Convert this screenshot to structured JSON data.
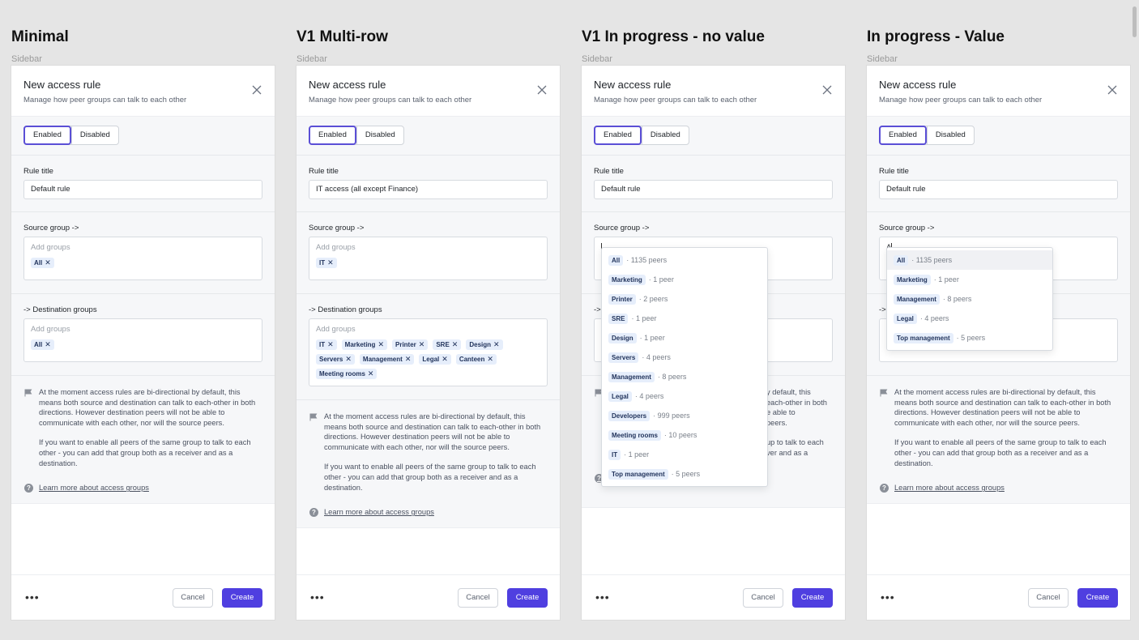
{
  "frames": [
    {
      "title": "Minimal",
      "subtitle": "Sidebar",
      "panel": {
        "title": "New access rule",
        "description": "Manage how peer groups can talk to each other",
        "status": {
          "enabled": "Enabled",
          "disabled": "Disabled",
          "selected": "Enabled"
        },
        "rule_title_label": "Rule title",
        "rule_title_value": "Default rule",
        "source_label": "Source group ->",
        "source_placeholder": "Add groups",
        "source_groups": [
          "All"
        ],
        "destination_label": "-> Destination groups",
        "destination_placeholder": "Add groups",
        "destination_groups": [
          "All"
        ],
        "note_1": "At the moment access rules are bi-directional by default, this means both source and destination can talk to each-other in both directions. However destination peers will not be able to communicate with each other, nor will the source peers.",
        "note_2": "If you want to enable all peers of the same group to talk to each other - you can add that group both as a receiver and as a destination.",
        "learn_more": "Learn more about access groups",
        "more": "•••",
        "cancel": "Cancel",
        "create": "Create"
      }
    },
    {
      "title": "V1 Multi-row",
      "subtitle": "Sidebar",
      "panel": {
        "title": "New access rule",
        "description": "Manage how peer groups can talk to each other",
        "status": {
          "enabled": "Enabled",
          "disabled": "Disabled",
          "selected": "Enabled"
        },
        "rule_title_label": "Rule title",
        "rule_title_value": "IT access (all except Finance)",
        "source_label": "Source group ->",
        "source_placeholder": "Add groups",
        "source_groups": [
          "IT"
        ],
        "destination_label": "-> Destination groups",
        "destination_placeholder": "Add groups",
        "destination_groups": [
          "IT",
          "Marketing",
          "Printer",
          "SRE",
          "Design",
          "Servers",
          "Management",
          "Legal",
          "Canteen",
          "Meeting rooms"
        ],
        "note_1": "At the moment access rules are bi-directional by default, this means both source and destination can talk to each-other in both directions. However destination peers will not be able to communicate with each other, nor will the source peers.",
        "note_2": "If you want to enable all peers of the same group to talk to each other - you can add that group both as a receiver and as a destination.",
        "learn_more": "Learn more about access groups",
        "more": "•••",
        "cancel": "Cancel",
        "create": "Create"
      }
    },
    {
      "title": "V1 In progress - no value",
      "subtitle": "Sidebar",
      "panel": {
        "title": "New access rule",
        "description": "Manage how peer groups can talk to each other",
        "status": {
          "enabled": "Enabled",
          "disabled": "Disabled",
          "selected": "Enabled"
        },
        "rule_title_label": "Rule title",
        "rule_title_value": "Default rule",
        "source_label": "Source group ->",
        "source_input": "",
        "destination_label_visible": "->",
        "note_visible_lines": [
          "y default, this",
          "each-other in both",
          "e able to",
          "peers.",
          "",
          "up to talk to each",
          "ver and as a"
        ],
        "more": "•••",
        "cancel": "Cancel",
        "create": "Create",
        "dropdown": [
          {
            "name": "All",
            "peers": "· 1135 peers"
          },
          {
            "name": "Marketing",
            "peers": "· 1 peer"
          },
          {
            "name": "Printer",
            "peers": "· 2 peers"
          },
          {
            "name": "SRE",
            "peers": "· 1 peer"
          },
          {
            "name": "Design",
            "peers": "· 1 peer"
          },
          {
            "name": "Servers",
            "peers": "· 4 peers"
          },
          {
            "name": "Management",
            "peers": "· 8 peers"
          },
          {
            "name": "Legal",
            "peers": "· 4 peers"
          },
          {
            "name": "Developers",
            "peers": "· 999 peers"
          },
          {
            "name": "Meeting rooms",
            "peers": "· 10 peers"
          },
          {
            "name": "IT",
            "peers": "· 1 peer"
          },
          {
            "name": "Top management",
            "peers": "· 5 peers"
          }
        ]
      }
    },
    {
      "title": "In progress - Value",
      "subtitle": "Sidebar",
      "panel": {
        "title": "New access rule",
        "description": "Manage how peer groups can talk to each other",
        "status": {
          "enabled": "Enabled",
          "disabled": "Disabled",
          "selected": "Enabled"
        },
        "rule_title_label": "Rule title",
        "rule_title_value": "Default rule",
        "source_label": "Source group ->",
        "source_input": "A",
        "destination_label_visible": "->",
        "note_1": "At the moment access rules are bi-directional by default, this means both source and destination can talk to each-other in both directions. However destination peers will not be able to communicate with each other, nor will the source peers.",
        "note_2": "If you want to enable all peers of the same group to talk to each other - you can add that group both as a receiver and as a destination.",
        "learn_more": "Learn more about access groups",
        "more": "•••",
        "cancel": "Cancel",
        "create": "Create",
        "dropdown": [
          {
            "name": "All",
            "peers": "· 1135 peers"
          },
          {
            "name": "Marketing",
            "peers": "· 1 peer"
          },
          {
            "name": "Management",
            "peers": "· 8 peers"
          },
          {
            "name": "Legal",
            "peers": "· 4 peers"
          },
          {
            "name": "Top management",
            "peers": "· 5 peers"
          }
        ]
      }
    }
  ],
  "colors": {
    "accent": "#4f3fe0",
    "selected_border": "#5b4fd6",
    "chip_bg": "#e6eefb",
    "canvas": "#e5e5e5"
  },
  "icons": {
    "close": "close-icon",
    "note": "flag-icon",
    "help": "question-circle-icon",
    "more": "more-horizontal-icon"
  }
}
